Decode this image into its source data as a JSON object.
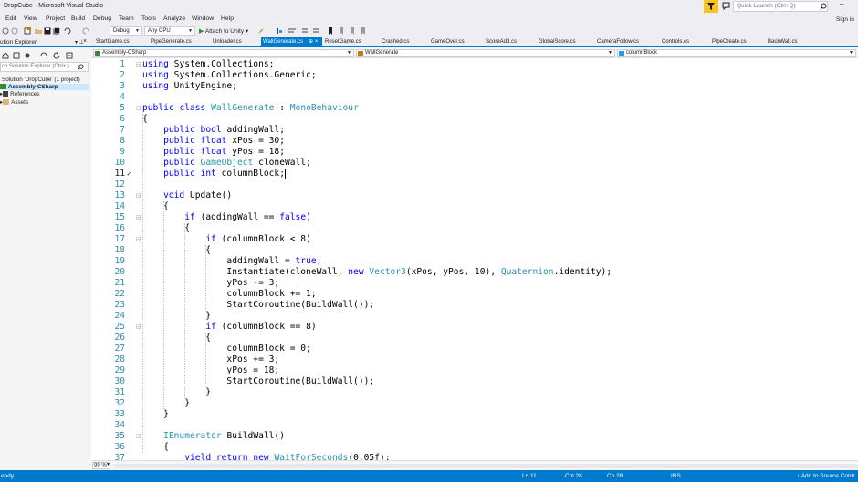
{
  "window": {
    "title": "DropCube - Microsoft Visual Studio",
    "quick_launch_placeholder": "Quick Launch (Ctrl+Q)",
    "minimize_glyph": "–",
    "sign_in": "Sign in"
  },
  "menu": [
    "Edit",
    "View",
    "Project",
    "Build",
    "Debug",
    "Team",
    "Tools",
    "Analyze",
    "Window",
    "Help"
  ],
  "toolbar": {
    "configuration": "Debug",
    "platform": "Any CPU",
    "attach": "Attach to Unity"
  },
  "solution_explorer": {
    "title": "ution Explorer",
    "search_placeholder": "ch Solution Explorer (Ctrl+;)",
    "pin_glyph": "▾ ⊥",
    "close_glyph": "×",
    "items": [
      {
        "label": "Solution 'DropCube' (1 project)"
      },
      {
        "label": "Assembly-CSharp"
      },
      {
        "label": "References"
      },
      {
        "label": "Assets"
      }
    ]
  },
  "tabs": [
    {
      "label": "StartGame.cs"
    },
    {
      "label": "PipeGenerate.cs"
    },
    {
      "label": "Unloader.cs"
    },
    {
      "label": "WallGenerate.cs"
    },
    {
      "label": "ResetGame.cs"
    },
    {
      "label": "Crashed.cs"
    },
    {
      "label": "GameOver.cs"
    },
    {
      "label": "ScoreAdd.cs"
    },
    {
      "label": "GlobalScore.cs"
    },
    {
      "label": "CameraFollow.cs"
    },
    {
      "label": "Controls.cs"
    },
    {
      "label": "PipeCreate.cs"
    },
    {
      "label": "BackWall.cs"
    }
  ],
  "tab_close_glyph": "⊕ ×",
  "navigation": {
    "project": "Assembly-CSharp",
    "class": "WallGenerate",
    "member": "columnBlock"
  },
  "editor": {
    "zoom": "99 %",
    "lines": [
      {
        "n": "1",
        "fold": "⊟",
        "t": [
          [
            "kw",
            "using"
          ],
          [
            "",
            "System.Collections;"
          ]
        ]
      },
      {
        "n": "2",
        "t": [
          [
            "kw",
            "using"
          ],
          [
            "",
            "System.Collections.Generic;"
          ]
        ]
      },
      {
        "n": "3",
        "t": [
          [
            "kw",
            "using"
          ],
          [
            "",
            "UnityEngine;"
          ]
        ]
      },
      {
        "n": "4",
        "t": []
      },
      {
        "n": "5",
        "fold": "⊟",
        "t": [
          [
            "kw",
            "public"
          ],
          [
            "kw",
            "class"
          ],
          [
            "ty",
            "WallGenerate"
          ],
          [
            "",
            ":"
          ],
          [
            "ty",
            "MonoBehaviour"
          ]
        ]
      },
      {
        "n": "6",
        "t": [
          [
            "",
            "{"
          ]
        ]
      },
      {
        "n": "7",
        "t": [
          [
            "",
            "    "
          ],
          [
            "kw",
            "public"
          ],
          [
            "kw",
            "bool"
          ],
          [
            "",
            "addingWall;"
          ]
        ]
      },
      {
        "n": "8",
        "t": [
          [
            "",
            "    "
          ],
          [
            "kw",
            "public"
          ],
          [
            "kw",
            "float"
          ],
          [
            "",
            "xPos = 30;"
          ]
        ]
      },
      {
        "n": "9",
        "t": [
          [
            "",
            "    "
          ],
          [
            "kw",
            "public"
          ],
          [
            "kw",
            "float"
          ],
          [
            "",
            "yPos = 18;"
          ]
        ]
      },
      {
        "n": "10",
        "t": [
          [
            "",
            "    "
          ],
          [
            "kw",
            "public"
          ],
          [
            "ty",
            "GameObject"
          ],
          [
            "",
            "cloneWall;"
          ]
        ]
      },
      {
        "n": "11",
        "current": true,
        "t": [
          [
            "",
            "    "
          ],
          [
            "kw",
            "public"
          ],
          [
            "kw",
            "int"
          ],
          [
            "",
            "columnBlock;"
          ]
        ]
      },
      {
        "n": "12",
        "t": []
      },
      {
        "n": "13",
        "fold": "⊟",
        "t": [
          [
            "",
            "    "
          ],
          [
            "kw",
            "void"
          ],
          [
            "",
            "Update()"
          ]
        ]
      },
      {
        "n": "14",
        "t": [
          [
            "",
            "    {"
          ]
        ]
      },
      {
        "n": "15",
        "fold": "⊟",
        "t": [
          [
            "",
            "        "
          ],
          [
            "kw",
            "if"
          ],
          [
            "",
            "(addingWall =="
          ],
          [
            "kw",
            "false"
          ],
          [
            ")",
            ""
          ]
        ]
      },
      {
        "n": "16",
        "t": [
          [
            "",
            "        {"
          ]
        ]
      },
      {
        "n": "17",
        "fold": "⊟",
        "t": [
          [
            "",
            "            "
          ],
          [
            "kw",
            "if"
          ],
          [
            "",
            "(columnBlock < 8)"
          ]
        ]
      },
      {
        "n": "18",
        "t": [
          [
            "",
            "            {"
          ]
        ]
      },
      {
        "n": "19",
        "t": [
          [
            "",
            "                addingWall ="
          ],
          [
            "kw",
            "true"
          ],
          [
            ";",
            ""
          ]
        ]
      },
      {
        "n": "20",
        "t": [
          [
            "",
            "                Instantiate(cloneWall,"
          ],
          [
            "kw",
            "new"
          ],
          [
            "ty",
            "Vector3"
          ],
          [
            "(xPos, yPos, 10),",
            ""
          ],
          [
            "ty",
            "Quaternion"
          ],
          [
            ".identity);",
            ""
          ]
        ]
      },
      {
        "n": "21",
        "t": [
          [
            "",
            "                yPos -= 3;"
          ]
        ]
      },
      {
        "n": "22",
        "t": [
          [
            "",
            "                columnBlock += 1;"
          ]
        ]
      },
      {
        "n": "23",
        "t": [
          [
            "",
            "                StartCoroutine(BuildWall());"
          ]
        ]
      },
      {
        "n": "24",
        "t": [
          [
            "",
            "            }"
          ]
        ]
      },
      {
        "n": "25",
        "fold": "⊟",
        "t": [
          [
            "",
            "            "
          ],
          [
            "kw",
            "if"
          ],
          [
            "",
            "(columnBlock == 8)"
          ]
        ]
      },
      {
        "n": "26",
        "t": [
          [
            "",
            "            {"
          ]
        ]
      },
      {
        "n": "27",
        "t": [
          [
            "",
            "                columnBlock = 0;"
          ]
        ]
      },
      {
        "n": "28",
        "t": [
          [
            "",
            "                xPos += 3;"
          ]
        ]
      },
      {
        "n": "29",
        "t": [
          [
            "",
            "                yPos = 18;"
          ]
        ]
      },
      {
        "n": "30",
        "t": [
          [
            "",
            "                StartCoroutine(BuildWall());"
          ]
        ]
      },
      {
        "n": "31",
        "t": [
          [
            "",
            "            }"
          ]
        ]
      },
      {
        "n": "32",
        "t": [
          [
            "",
            "        }"
          ]
        ]
      },
      {
        "n": "33",
        "t": [
          [
            "",
            "    }"
          ]
        ]
      },
      {
        "n": "34",
        "t": []
      },
      {
        "n": "35",
        "fold": "⊟",
        "t": [
          [
            "",
            "    "
          ],
          [
            "ty",
            "IEnumerator"
          ],
          [
            "",
            "BuildWall()"
          ]
        ]
      },
      {
        "n": "36",
        "t": [
          [
            "",
            "    {"
          ]
        ]
      },
      {
        "n": "37",
        "t": [
          [
            "",
            "        "
          ],
          [
            "kw",
            "yield"
          ],
          [
            "kw",
            "return"
          ],
          [
            "kw",
            "new"
          ],
          [
            "ty",
            "WaitForSeconds"
          ],
          [
            "(0.05f);",
            ""
          ]
        ]
      }
    ]
  },
  "status": {
    "ready": "eady",
    "ln": "Ln 11",
    "col": "Col 28",
    "ch": "Ch 28",
    "ins": "INS",
    "source_control": "↑  Add to Source Contr"
  },
  "colors": {
    "accent": "#007acc",
    "keyword": "#0000ff",
    "type": "#2b91af",
    "highlight": "#f6c521"
  }
}
